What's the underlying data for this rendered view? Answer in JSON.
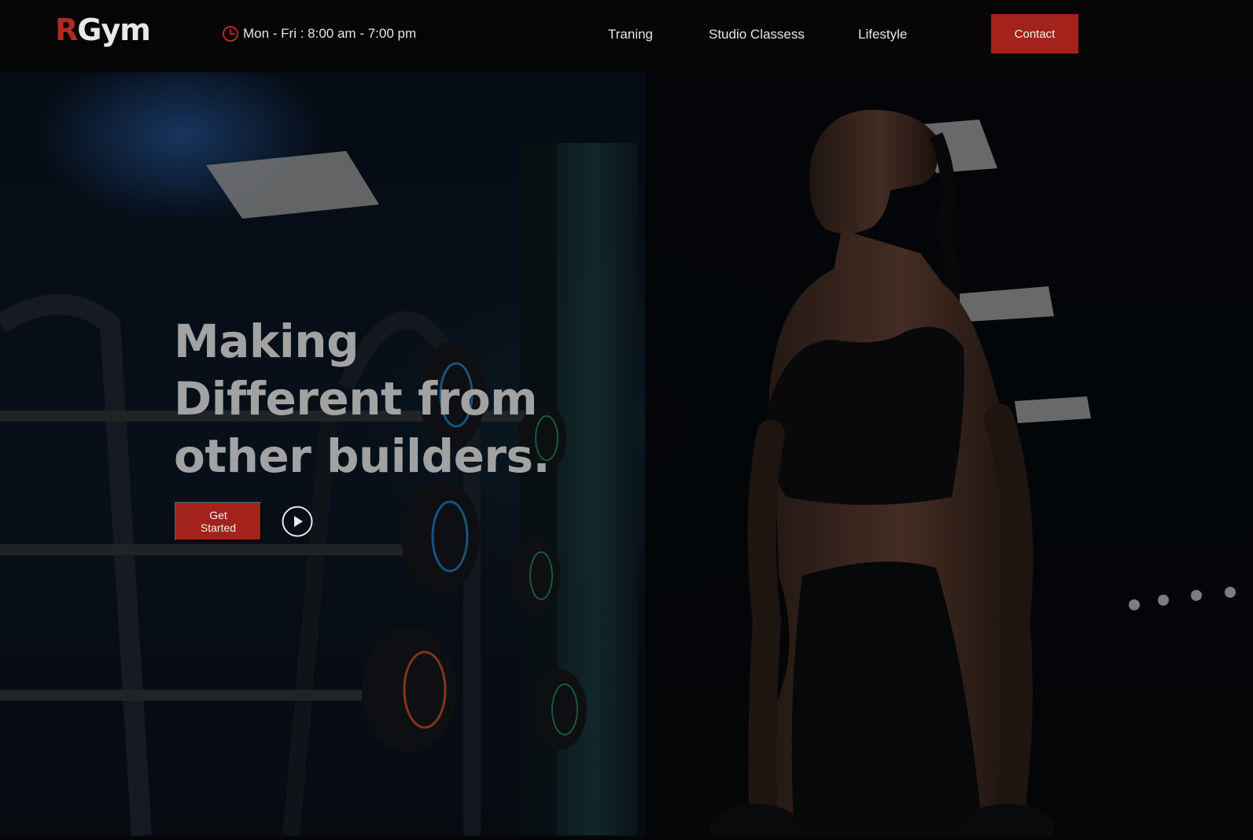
{
  "brand": {
    "logo_r": "R",
    "logo_rest": "Gym"
  },
  "header": {
    "hours_text": "Mon - Fri : 8:00 am - 7:00 pm",
    "nav": [
      {
        "label": "Traning"
      },
      {
        "label": "Studio Classess"
      },
      {
        "label": "Lifestyle"
      }
    ],
    "contact_label": "Contact"
  },
  "hero": {
    "headline_lines": [
      "Making",
      "Different from",
      "other builders."
    ],
    "cta_label": "Get\nStarted"
  },
  "colors": {
    "accent": "#a3221c",
    "header_bg": "#050505",
    "headline": "#a2a2a2",
    "nav_text": "#e6e6e6"
  },
  "icons": {
    "hours": "clock-icon",
    "play": "play-icon"
  }
}
